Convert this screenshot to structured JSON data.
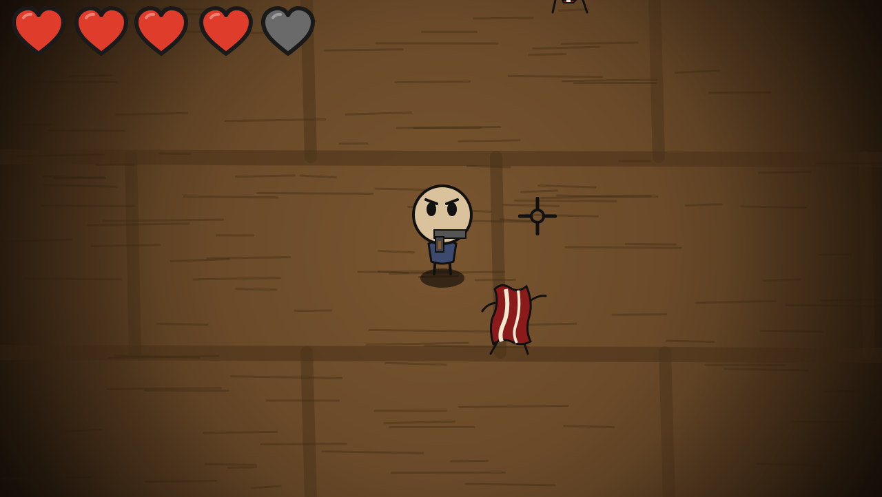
{
  "hud": {
    "health": {
      "max_hearts": 5,
      "current_hearts": 4,
      "full_color": "#e03c2c",
      "empty_color": "#6a6a6a"
    }
  },
  "entities": {
    "player": {
      "label": "player",
      "weapon": "pistol",
      "skin_color": "#d9c29c",
      "outfit_color": "#3b4a6e"
    },
    "enemy_bacon": {
      "label": "bacon-enemy",
      "colors": [
        "#8b1a1a",
        "#f1ead0"
      ]
    },
    "enemy_partial_top": {
      "label": "bacon-enemy-offscreen"
    }
  },
  "crosshair": {
    "color": "#111111"
  },
  "colors": {
    "floor_base": "#6b4a2a",
    "floor_dark": "#3a2812",
    "plank_seam": "#4a3219",
    "vignette": "#1a1208"
  }
}
